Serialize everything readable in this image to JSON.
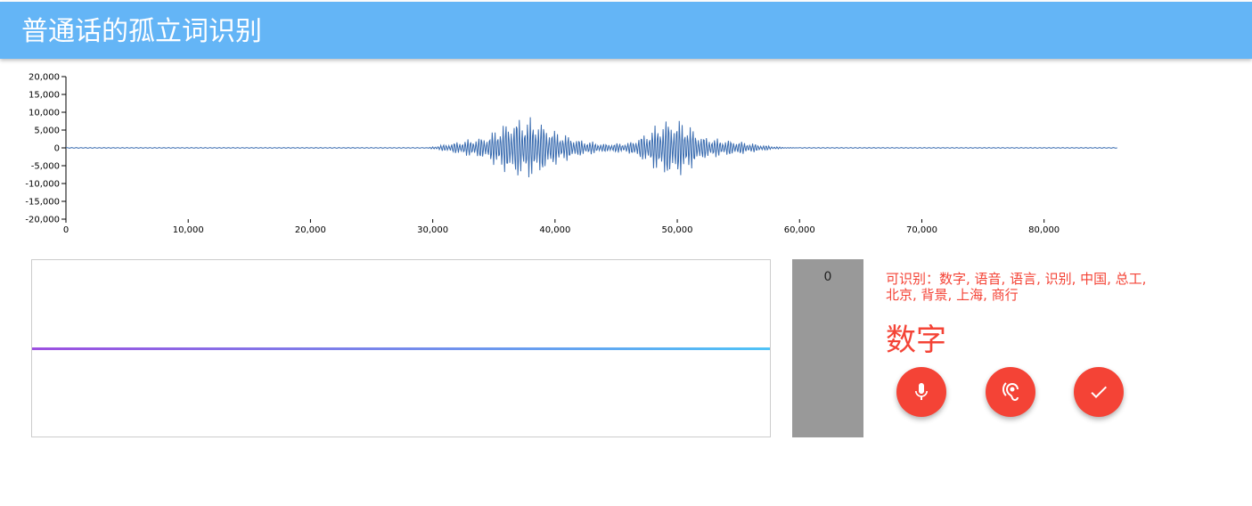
{
  "app": {
    "title": "普通话的孤立词识别"
  },
  "waveform": {
    "type": "line",
    "x_ticks": [
      "0",
      "10,000",
      "20,000",
      "30,000",
      "40,000",
      "50,000",
      "60,000",
      "70,000",
      "80,000"
    ],
    "x_tick_values": [
      0,
      10000,
      20000,
      30000,
      40000,
      50000,
      60000,
      70000,
      80000
    ],
    "y_ticks": [
      "20,000",
      "15,000",
      "10,000",
      "5,000",
      "0",
      "-5,000",
      "-10,000",
      "-15,000",
      "-20,000"
    ],
    "y_tick_values": [
      20000,
      15000,
      10000,
      5000,
      0,
      -5000,
      -10000,
      -15000,
      -20000
    ],
    "xlim": [
      0,
      86000
    ],
    "ylim": [
      -20000,
      20000
    ],
    "color": "#3a6cb0"
  },
  "chart_data": {
    "type": "line",
    "title": "",
    "xlabel": "",
    "ylabel": "",
    "xlim": [
      0,
      86000
    ],
    "ylim": [
      -20000,
      20000
    ],
    "series": [
      {
        "x": [
          0,
          29500,
          31000,
          33000,
          34500,
          35500,
          37000,
          38500,
          40000,
          42000,
          44000,
          46000,
          47500,
          49000,
          50500,
          52000,
          53500,
          55000,
          57000,
          58500,
          60000,
          86000
        ],
        "envelope": [
          0,
          0,
          1000,
          2500,
          3500,
          6500,
          9000,
          8500,
          5000,
          2500,
          1200,
          1500,
          4500,
          8500,
          8000,
          3500,
          2500,
          2000,
          800,
          200,
          0,
          0
        ]
      }
    ]
  },
  "visualizer": {
    "gradient_start": "#9c4fe0",
    "gradient_end": "#4fc3f7"
  },
  "counter": {
    "value": "0"
  },
  "recognition": {
    "vocab_label": "可识别：数字, 语音, 语言, 识别, 中国, 总工, 北京, 背景, 上海, 商行",
    "result": "数字",
    "accent": "#f44336"
  },
  "buttons": [
    {
      "name": "record-button",
      "icon": "mic-icon"
    },
    {
      "name": "listen-button",
      "icon": "hearing-icon"
    },
    {
      "name": "confirm-button",
      "icon": "check-icon"
    }
  ]
}
